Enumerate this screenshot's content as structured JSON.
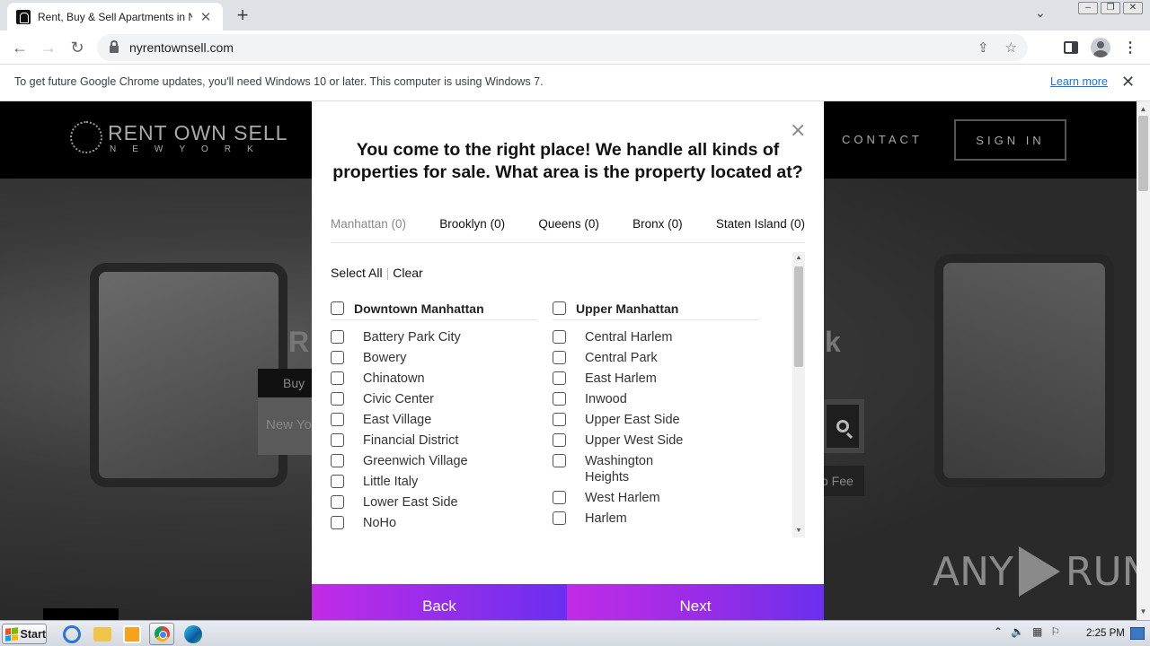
{
  "browser": {
    "tab_title": "Rent, Buy & Sell Apartments in New York",
    "tab_close": "✕",
    "new_tab": "+",
    "url": "nyrentownsell.com",
    "infobar_text": "To get future Google Chrome updates, you'll need Windows 10 or later. This computer is using Windows 7.",
    "infobar_link": "Learn more",
    "infobar_close": "✕"
  },
  "site": {
    "logo_main": "RENT OWN SELL",
    "logo_sub": "NEWYORK",
    "nav_contact": "CONTACT",
    "signin": "SIGN IN",
    "hero_left": "R",
    "hero_right": "k",
    "buy_tab": "Buy",
    "search_placeholder": "New Yo",
    "no_fee": "o Fee"
  },
  "modal": {
    "close": "×",
    "question": "You come to the right place! We handle all kinds of properties for sale. What area is the property located at?",
    "boroughs": [
      {
        "label": "Manhattan (0)",
        "active": true
      },
      {
        "label": "Brooklyn (0)",
        "active": false
      },
      {
        "label": "Queens (0)",
        "active": false
      },
      {
        "label": "Bronx (0)",
        "active": false
      },
      {
        "label": "Staten Island (0)",
        "active": false
      }
    ],
    "select_all": "Select All",
    "separator": "|",
    "clear": "Clear",
    "columns": [
      {
        "heading": "Downtown Manhattan",
        "items": [
          "Battery Park City",
          "Bowery",
          "Chinatown",
          "Civic Center",
          "East Village",
          "Financial District",
          "Greenwich Village",
          "Little Italy",
          "Lower East Side",
          "NoHo"
        ]
      },
      {
        "heading": "Upper Manhattan",
        "items": [
          "Central Harlem",
          "Central Park",
          "East Harlem",
          "Inwood",
          "Upper East Side",
          "Upper West Side",
          "Washington Heights",
          "West Harlem",
          "Harlem"
        ]
      }
    ],
    "back_label": "Back",
    "next_label": "Next"
  },
  "watermark": {
    "text_left": "ANY",
    "text_right": "RUN"
  },
  "taskbar": {
    "start_label": "Start",
    "clock": "2:25 PM"
  },
  "colors": {
    "button_gradient_start": "#c22be6",
    "button_gradient_end": "#6a2ff0",
    "link_blue": "#1a73e8"
  }
}
